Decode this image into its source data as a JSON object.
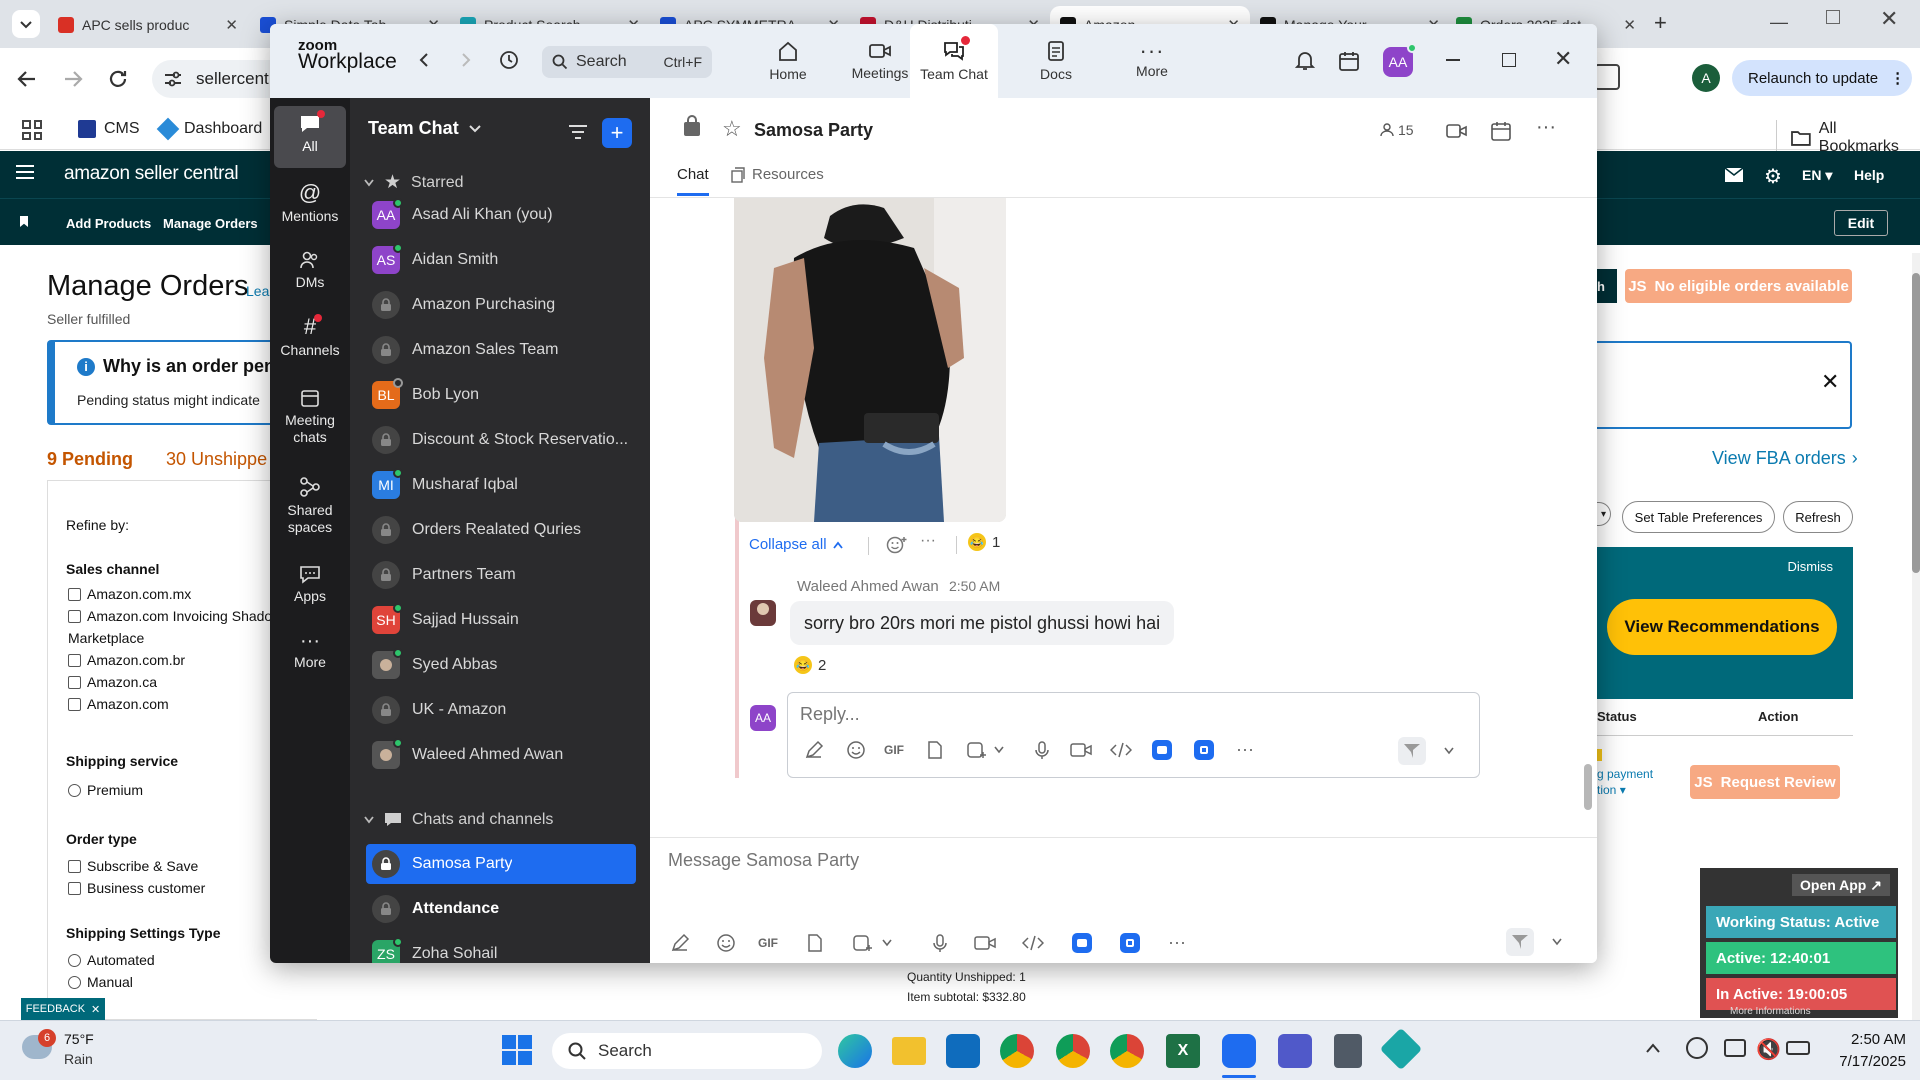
{
  "browser": {
    "tabs": [
      {
        "title": "APC sells produc",
        "color": "#d93025"
      },
      {
        "title": "Simple Data Tab",
        "color": "#1a4fd6"
      },
      {
        "title": "Product Search",
        "color": "#1aa7b8"
      },
      {
        "title": "APC SYMMETRA",
        "color": "#1a4fd6"
      },
      {
        "title": "D&H Distributi",
        "color": "#c4122f"
      },
      {
        "title": "Amazon",
        "color": "#111111"
      },
      {
        "title": "Manage Your",
        "color": "#111111"
      },
      {
        "title": "Orders 2025 dat",
        "color": "#1e8e3e"
      }
    ],
    "url": "sellercent",
    "profile_initial": "A",
    "relaunch_label": "Relaunch to update",
    "bookmarks": [
      {
        "label": "CMS"
      },
      {
        "label": "Dashboard"
      }
    ],
    "all_bookmarks": "All Bookmarks"
  },
  "amazon": {
    "logo": "amazon seller central",
    "nav": [
      "Add Products",
      "Manage Orders"
    ],
    "lang": "EN",
    "help": "Help",
    "edit": "Edit",
    "page_title": "Manage Orders",
    "learn": "Lea",
    "subtitle": "Seller fulfilled",
    "info_title": "Why is an order pen",
    "info_text": "Pending status might indicate",
    "tabs": {
      "pending": "9 Pending",
      "unshipped": "30 Unshippe"
    },
    "refine": "Refine by:",
    "sales_channel": {
      "title": "Sales channel",
      "items": [
        "Amazon.com.mx",
        "Amazon.com Invoicing Shado",
        "Marketplace",
        "Amazon.com.br",
        "Amazon.ca",
        "Amazon.com"
      ]
    },
    "shipping_service": {
      "title": "Shipping service",
      "items": [
        "Premium"
      ]
    },
    "order_type": {
      "title": "Order type",
      "items": [
        "Subscribe & Save",
        "Business customer"
      ]
    },
    "shipping_settings": {
      "title": "Shipping Settings Type",
      "items": [
        "Automated",
        "Manual"
      ]
    },
    "no_eligible": "No eligible orders available",
    "view_fba": "View FBA orders",
    "set_table": "Set Table Preferences",
    "refresh": "Refresh",
    "dismiss": "Dismiss",
    "view_recs": "View Recommendations",
    "col_status": "Status",
    "col_action": "Action",
    "payment_text": "g payment",
    "payment_text2": "tion",
    "request_review": "Request Review",
    "qty_unshipped": "Quantity Unshipped: 1",
    "item_subtotal": "Item subtotal: $332.80",
    "feedback": "FEEDBACK",
    "open_app": "Open App",
    "working_status": "Working Status: Active",
    "active_time": "Active: 12:40:01",
    "inactive_time": "In Active: 19:00:05",
    "more_info": "More Informations"
  },
  "zoom": {
    "brand_top": "zoom",
    "brand_bottom": "Workplace",
    "search": "Search",
    "search_shortcut": "Ctrl+F",
    "nav": [
      {
        "label": "Home"
      },
      {
        "label": "Meetings"
      },
      {
        "label": "Team Chat"
      },
      {
        "label": "Docs"
      },
      {
        "label": "More"
      }
    ],
    "user_initials": "AA",
    "rail": [
      {
        "label": "All"
      },
      {
        "label": "Mentions"
      },
      {
        "label": "DMs"
      },
      {
        "label": "Channels"
      },
      {
        "label": "Meeting chats"
      },
      {
        "label": "Shared spaces"
      },
      {
        "label": "Apps"
      },
      {
        "label": "More"
      }
    ],
    "list_title": "Team Chat",
    "starred_label": "Starred",
    "starred": [
      {
        "name": "Asad Ali Khan (you)",
        "initials": "AA",
        "color": "#8e44c9",
        "type": "avatar"
      },
      {
        "name": "Aidan Smith",
        "initials": "AS",
        "color": "#8e44c9",
        "type": "avatar"
      },
      {
        "name": "Amazon Purchasing",
        "type": "lock"
      },
      {
        "name": "Amazon Sales Team",
        "type": "lock"
      },
      {
        "name": "Bob Lyon",
        "initials": "BL",
        "color": "#e46b1a",
        "type": "avatar"
      },
      {
        "name": "Discount & Stock Reservatio...",
        "type": "lock"
      },
      {
        "name": "Musharaf Iqbal",
        "initials": "MI",
        "color": "#2a7de1",
        "type": "avatar"
      },
      {
        "name": "Orders Realated Quries",
        "type": "lock"
      },
      {
        "name": "Partners Team",
        "type": "lock"
      },
      {
        "name": "Sajjad Hussain",
        "initials": "SH",
        "color": "#e0443a",
        "type": "avatar"
      },
      {
        "name": "Syed Abbas",
        "type": "photo"
      },
      {
        "name": "UK - Amazon",
        "type": "lock"
      },
      {
        "name": "Waleed Ahmed Awan",
        "type": "photo"
      }
    ],
    "chats_label": "Chats and channels",
    "chats": [
      {
        "name": "Samosa Party",
        "type": "lock"
      },
      {
        "name": "Attendance",
        "type": "lock"
      },
      {
        "name": "Zoha Sohail",
        "initials": "ZS",
        "color": "#2aa566",
        "type": "avatar"
      }
    ],
    "channel_title": "Samosa Party",
    "member_count": "15",
    "tab_chat": "Chat",
    "tab_resources": "Resources",
    "collapse_all": "Collapse all",
    "reaction1_count": "1",
    "reply_author": "Waleed Ahmed Awan",
    "reply_time": "2:50 AM",
    "reply_text": "sorry bro 20rs mori me pistol ghussi howi hai",
    "reaction2_count": "2",
    "reply_placeholder": "Reply...",
    "reply_avatar": "AA",
    "message_placeholder": "Message Samosa Party",
    "gif": "GIF"
  },
  "taskbar": {
    "temp": "75°F",
    "weather": "Rain",
    "weather_badge": "6",
    "search": "Search",
    "time": "2:50 AM",
    "date": "7/17/2025"
  }
}
